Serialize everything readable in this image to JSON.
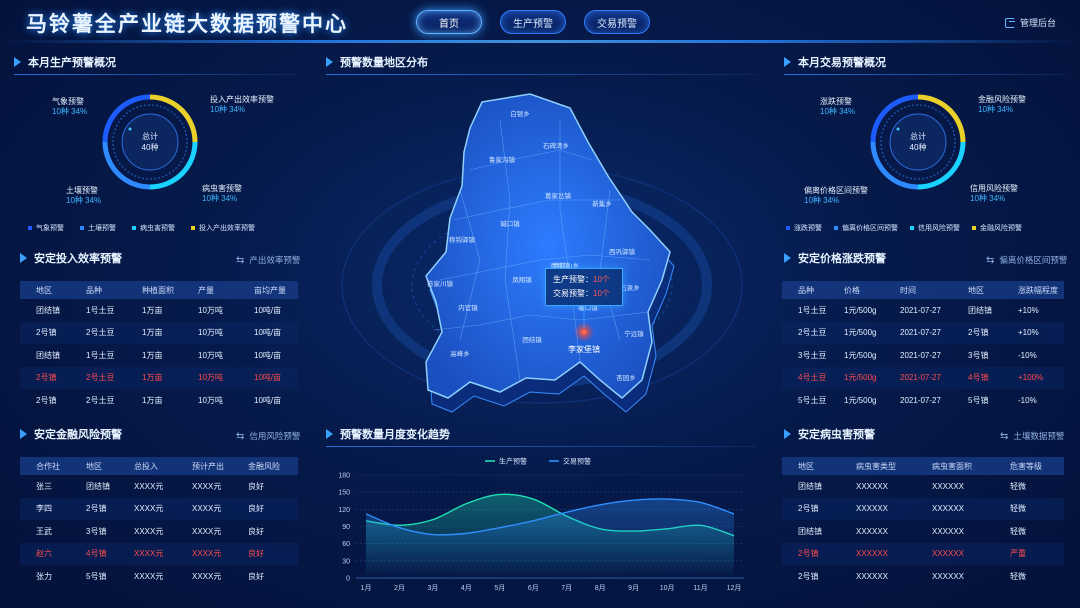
{
  "header": {
    "title": "马铃薯全产业链大数据预警中心",
    "nav": [
      "首页",
      "生产预警",
      "交易预警"
    ],
    "admin": "管理后台"
  },
  "production_overview": {
    "title": "本月生产预警概况",
    "center_label": "总计",
    "center_value": "40种",
    "items": [
      {
        "name": "气象预警",
        "detail": "10种  34%",
        "color": "#1e5bff"
      },
      {
        "name": "土壤预警",
        "detail": "10种  34%",
        "color": "#2d8bff"
      },
      {
        "name": "病虫害预警",
        "detail": "10种  34%",
        "color": "#19d2ff"
      },
      {
        "name": "投入产出效率预警",
        "detail": "10种  34%",
        "color": "#e9d12a"
      }
    ]
  },
  "trade_overview": {
    "title": "本月交易预警概况",
    "center_label": "总计",
    "center_value": "40种",
    "items": [
      {
        "name": "涨跌预警",
        "detail": "10种  34%",
        "color": "#1e5bff"
      },
      {
        "name": "偏离价格区间预警",
        "detail": "10种  34%",
        "color": "#2d8bff"
      },
      {
        "name": "信用风险预警",
        "detail": "10种  34%",
        "color": "#19d2ff"
      },
      {
        "name": "金融风险预警",
        "detail": "10种  34%",
        "color": "#e9d12a"
      }
    ]
  },
  "input_efficiency": {
    "title": "安定投入效率预警",
    "switch_label": "产出效率预警",
    "headers": [
      "地区",
      "品种",
      "种植面积",
      "产量",
      "亩均产量"
    ],
    "rows": [
      {
        "cells": [
          "团结镇",
          "1号土豆",
          "1万亩",
          "10万吨",
          "10吨/亩"
        ],
        "warn": false
      },
      {
        "cells": [
          "2号镇",
          "2号土豆",
          "1万亩",
          "10万吨",
          "10吨/亩"
        ],
        "warn": false
      },
      {
        "cells": [
          "团结镇",
          "1号土豆",
          "1万亩",
          "10万吨",
          "10吨/亩"
        ],
        "warn": false
      },
      {
        "cells": [
          "2号镇",
          "2号土豆",
          "1万亩",
          "10万吨",
          "10吨/亩"
        ],
        "warn": true
      },
      {
        "cells": [
          "2号镇",
          "2号土豆",
          "1万亩",
          "10万吨",
          "10吨/亩"
        ],
        "warn": false
      }
    ]
  },
  "finance_risk": {
    "title": "安定金融风险预警",
    "switch_label": "信用风险预警",
    "headers": [
      "合作社",
      "地区",
      "总投入",
      "预计产出",
      "金融风险"
    ],
    "rows": [
      {
        "cells": [
          "张三",
          "团结镇",
          "XXXX元",
          "XXXX元",
          "良好"
        ],
        "warn": false
      },
      {
        "cells": [
          "李四",
          "2号镇",
          "XXXX元",
          "XXXX元",
          "良好"
        ],
        "warn": false
      },
      {
        "cells": [
          "王武",
          "3号镇",
          "XXXX元",
          "XXXX元",
          "良好"
        ],
        "warn": false
      },
      {
        "cells": [
          "赵六",
          "4号镇",
          "XXXX元",
          "XXXX元",
          "良好"
        ],
        "warn": true
      },
      {
        "cells": [
          "张力",
          "5号镇",
          "XXXX元",
          "XXXX元",
          "良好"
        ],
        "warn": false
      }
    ]
  },
  "price_change": {
    "title": "安定价格涨跌预警",
    "switch_label": "偏离价格区间预警",
    "headers": [
      "品种",
      "价格",
      "时间",
      "地区",
      "涨跌幅程度"
    ],
    "rows": [
      {
        "cells": [
          "1号土豆",
          "1元/500g",
          "2021-07-27",
          "团结镇",
          "+10%"
        ],
        "warn": false
      },
      {
        "cells": [
          "2号土豆",
          "1元/500g",
          "2021-07-27",
          "2号镇",
          "+10%"
        ],
        "warn": false
      },
      {
        "cells": [
          "3号土豆",
          "1元/500g",
          "2021-07-27",
          "3号镇",
          "-10%"
        ],
        "warn": false
      },
      {
        "cells": [
          "4号土豆",
          "1元/500g",
          "2021-07-27",
          "4号镇",
          "+100%"
        ],
        "warn": true
      },
      {
        "cells": [
          "5号土豆",
          "1元/500g",
          "2021-07-27",
          "5号镇",
          "-10%"
        ],
        "warn": false
      }
    ]
  },
  "pest": {
    "title": "安定病虫害预警",
    "switch_label": "土壤数据预警",
    "headers": [
      "地区",
      "病虫害类型",
      "病虫害面积",
      "危害等级"
    ],
    "rows": [
      {
        "cells": [
          "团结镇",
          "XXXXXX",
          "XXXXXX",
          "轻微"
        ],
        "warn": false
      },
      {
        "cells": [
          "2号镇",
          "XXXXXX",
          "XXXXXX",
          "轻微"
        ],
        "warn": false
      },
      {
        "cells": [
          "团结镇",
          "XXXXXX",
          "XXXXXX",
          "轻微"
        ],
        "warn": false
      },
      {
        "cells": [
          "2号镇",
          "XXXXXX",
          "XXXXXX",
          "严重"
        ],
        "warn": true
      },
      {
        "cells": [
          "2号镇",
          "XXXXXX",
          "XXXXXX",
          "轻微"
        ],
        "warn": false
      }
    ]
  },
  "map": {
    "title": "预警数量地区分布",
    "towns": [
      "白银乡",
      "石碑湾乡",
      "鲁家沟镇",
      "葛家岔镇",
      "新集乡",
      "碱口镇",
      "称钩驿镇",
      "西巩驿镇",
      "香泉镇",
      "凤翔镇",
      "巉口镇",
      "内官镇",
      "团结镇",
      "李家堡镇",
      "宁远镇",
      "高峰乡",
      "青岚山乡",
      "石泉乡",
      "杏园乡",
      "符家川镇"
    ],
    "highlight": "李家堡镇",
    "tooltip": {
      "line1": "生产预警：",
      "value1": "10个",
      "line2": "交易预警：",
      "value2": "10个"
    }
  },
  "chart_data": {
    "type": "line",
    "title": "预警数量月度变化趋势",
    "categories": [
      "1月",
      "2月",
      "3月",
      "4月",
      "5月",
      "6月",
      "7月",
      "8月",
      "9月",
      "10月",
      "11月",
      "12月"
    ],
    "ylim": [
      0,
      180
    ],
    "yticks": [
      0,
      30,
      60,
      90,
      120,
      150,
      180
    ],
    "legend_position": "top-center",
    "series": [
      {
        "name": "生产预警",
        "color": "#1fe0b5",
        "values": [
          100,
          92,
          102,
          130,
          146,
          138,
          108,
          86,
          82,
          86,
          92,
          74
        ]
      },
      {
        "name": "交易预警",
        "color": "#2f8fff",
        "values": [
          112,
          88,
          76,
          78,
          88,
          100,
          115,
          128,
          136,
          138,
          132,
          112
        ]
      }
    ]
  }
}
